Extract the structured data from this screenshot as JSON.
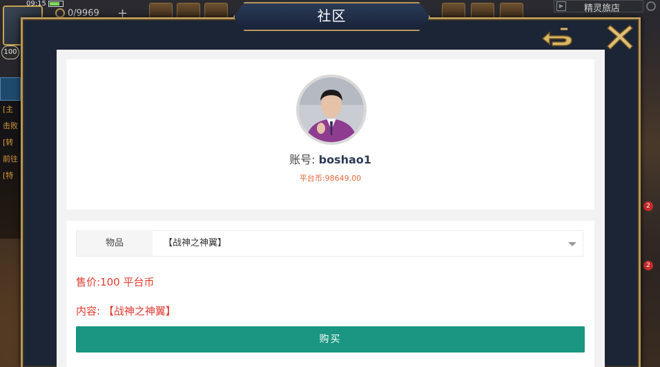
{
  "hud": {
    "time": "09:15",
    "stamina": "0/9969",
    "plus": "+",
    "level": "100",
    "right_tab_label": "精灵旅店",
    "side_badge": "2",
    "chat_lines": [
      "[主",
      "击败",
      "[转",
      "前往",
      "[特"
    ]
  },
  "modal": {
    "title": "社区"
  },
  "profile": {
    "account_label": "账号:",
    "account_value": "boshao1",
    "coin_label": "平台币:",
    "coin_value": "98649.00"
  },
  "form": {
    "item_label": "物品",
    "item_selected": "【战神之神翼】",
    "price_text": "售价:100 平台币",
    "content_text": "内容: 【战神之神翼】",
    "buy_label": "购买"
  },
  "colors": {
    "accent_teal": "#1a9682",
    "price_red": "#e03a2f",
    "coin_orange": "#e0663a",
    "frame_gold": "#b8985a",
    "frame_navy": "#1b2536"
  }
}
